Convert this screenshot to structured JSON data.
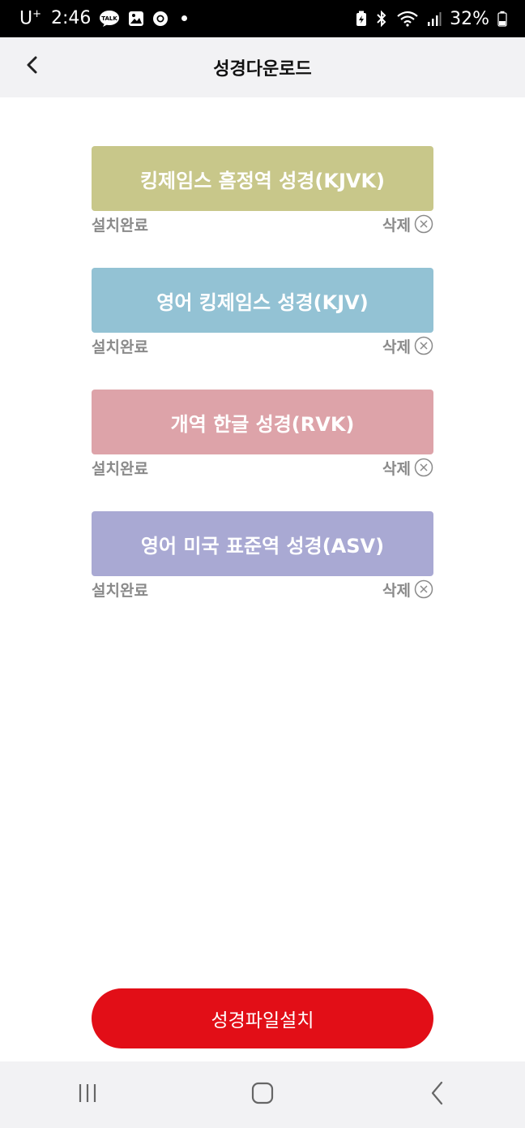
{
  "status_bar": {
    "carrier": "U",
    "carrier_sup": "+",
    "time": "2:46",
    "talk_badge": "TALK",
    "battery_percent": "32%"
  },
  "header": {
    "title": "성경다운로드"
  },
  "bibles": [
    {
      "name": "킹제임스 흠정역 성경(KJVK)",
      "status": "설치완료",
      "delete_label": "삭제",
      "color": "#c8c78a"
    },
    {
      "name": "영어 킹제임스 성경(KJV)",
      "status": "설치완료",
      "delete_label": "삭제",
      "color": "#93c2d4"
    },
    {
      "name": "개역 한글 성경(RVK)",
      "status": "설치완료",
      "delete_label": "삭제",
      "color": "#dda3a9"
    },
    {
      "name": "영어 미국 표준역 성경(ASV)",
      "status": "설치완료",
      "delete_label": "삭제",
      "color": "#a9a9d3"
    }
  ],
  "install_button": {
    "label": "성경파일설치",
    "color": "#e20e17"
  },
  "icons": {
    "back": "chevron-left-icon",
    "delete": "x-circle-icon",
    "nav_recents": "recents-icon",
    "nav_home": "home-icon",
    "nav_back": "back-icon"
  }
}
